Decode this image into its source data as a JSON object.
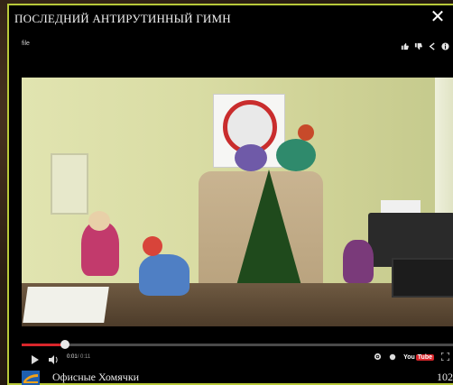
{
  "lightbox": {
    "title": "ПОСЛЕДНИЙ АНТИРУТИННЫЙ ГИМН",
    "close_icon": "close-icon",
    "border_color": "#b8c93a"
  },
  "player": {
    "top_label": "file",
    "top_icons": [
      "thumbs-up-icon",
      "thumbs-down-icon",
      "share-icon",
      "info-icon"
    ],
    "current_time": "0:01",
    "total_time": "/ 0:11",
    "progress_fraction": 0.1,
    "progress_color": "#d9262b",
    "control_icons": [
      "play-icon",
      "volume-icon",
      "settings-icon",
      "watch-later-icon",
      "youtube-logo",
      "fullscreen-icon"
    ],
    "youtube_logo_text": "You",
    "youtube_logo_tube": "Tube"
  },
  "footer": {
    "channel_name": "Офисные Хомячки",
    "view_count": "102"
  }
}
